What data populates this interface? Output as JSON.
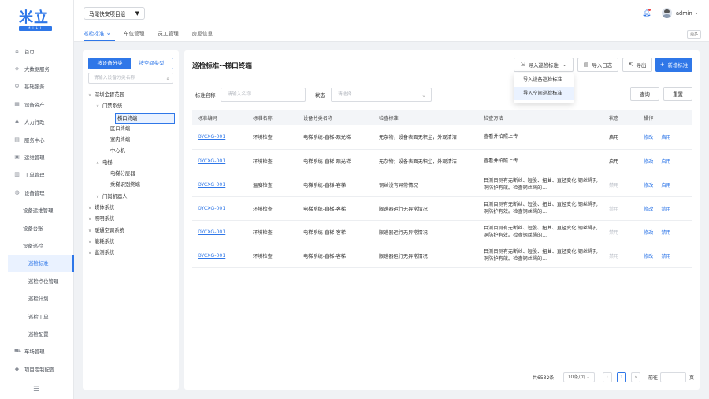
{
  "brand": {
    "logo_text": "米立",
    "logo_sub": "MILI"
  },
  "nav": [
    {
      "label": "首页",
      "icon": "home-icon",
      "glyph": "⌂",
      "level": 0
    },
    {
      "label": "大数据服务",
      "icon": "data-icon",
      "glyph": "◈",
      "level": 0
    },
    {
      "label": "基础服务",
      "icon": "service-icon",
      "glyph": "⚙",
      "level": 0
    },
    {
      "label": "设备资产",
      "icon": "asset-icon",
      "glyph": "▦",
      "level": 0
    },
    {
      "label": "人力行政",
      "icon": "people-icon",
      "glyph": "♟",
      "level": 0
    },
    {
      "label": "服务中心",
      "icon": "center-icon",
      "glyph": "▤",
      "level": 0
    },
    {
      "label": "运维管理",
      "icon": "ops-icon",
      "glyph": "▣",
      "level": 0
    },
    {
      "label": "工单管理",
      "icon": "ticket-icon",
      "glyph": "▥",
      "level": 0
    },
    {
      "label": "设备管理",
      "icon": "device-icon",
      "glyph": "◍",
      "level": 0
    },
    {
      "label": "设备运维管理",
      "level": 1
    },
    {
      "label": "设备台账",
      "level": 1
    },
    {
      "label": "设备巡检",
      "level": 1
    },
    {
      "label": "巡检标准",
      "level": 2,
      "active": true
    },
    {
      "label": "巡检点位管理",
      "level": 2
    },
    {
      "label": "巡检计划",
      "level": 2
    },
    {
      "label": "巡检工单",
      "level": 2
    },
    {
      "label": "巡检配置",
      "level": 2
    },
    {
      "label": "车场管理",
      "icon": "car-icon",
      "glyph": "⛟",
      "level": 0
    },
    {
      "label": "项目定制配置",
      "icon": "config-icon",
      "glyph": "◆",
      "level": 0
    }
  ],
  "topbar": {
    "project": "马尾快安项目组",
    "user": "admin",
    "more": "更多"
  },
  "tabs": [
    {
      "label": "巡检标准",
      "active": true
    },
    {
      "label": "车位管理"
    },
    {
      "label": "员工管理"
    },
    {
      "label": "房屋信息"
    }
  ],
  "left": {
    "seg_on": "按设备分类",
    "seg_off": "按空间类型",
    "search_placeholder": "请输入设备分类名称",
    "tree": [
      {
        "label": "深圳金碧花园",
        "depth": 0,
        "caret": "∨"
      },
      {
        "label": "门禁系统",
        "depth": 1,
        "caret": "∨"
      },
      {
        "label": "梯口终端",
        "depth": 2,
        "selected": true
      },
      {
        "label": "区口终端",
        "depth": 2
      },
      {
        "label": "室内终端",
        "depth": 2
      },
      {
        "label": "中心机",
        "depth": 2
      },
      {
        "label": "电梯",
        "depth": 1,
        "caret": "∧"
      },
      {
        "label": "电梯分层器",
        "depth": 2
      },
      {
        "label": "乘梯识别终端",
        "depth": 2
      },
      {
        "label": "门岗机器人",
        "depth": 1,
        "caret": "∨"
      },
      {
        "label": "媒体系统",
        "depth": 0,
        "caret": "∨"
      },
      {
        "label": "照明系统",
        "depth": 0,
        "caret": "∨"
      },
      {
        "label": "暖通空调系统",
        "depth": 0,
        "caret": "∨"
      },
      {
        "label": "能耗系统",
        "depth": 0,
        "caret": "∨"
      },
      {
        "label": "监测系统",
        "depth": 0,
        "caret": "∨"
      }
    ]
  },
  "main": {
    "title": "巡检标准--梯口终端",
    "buttons": {
      "import": "导入巡检标准",
      "log": "导入日志",
      "export": "导出",
      "add": "新增标准"
    },
    "dropdown": [
      "导入设备巡检标准",
      "导入空间巡检标准"
    ],
    "filters": {
      "name_label": "标准名称",
      "name_placeholder": "请输入名称",
      "status_label": "状态",
      "status_placeholder": "请选择",
      "query": "查询",
      "reset": "重置"
    },
    "columns": [
      "标准编码",
      "标准名称",
      "设备分类名称",
      "检查标准",
      "检查方法",
      "状态",
      "操作"
    ],
    "rows": [
      {
        "code": "DYCXG-001",
        "name": "环境检查",
        "cat": "电梯系统-直梯-观光梯",
        "std": "无杂物；设备表面无积尘，外观清洁",
        "method": "查看并拍照上传",
        "status": "启用",
        "op1": "修改",
        "op2": "启用",
        "enabled": true
      },
      {
        "code": "DYCXG-001",
        "name": "环境检查",
        "cat": "电梯系统-直梯-观光梯",
        "std": "无杂物；设备表面无积尘，外观清洁",
        "method": "查看并拍照上传",
        "status": "启用",
        "op1": "修改",
        "op2": "启用",
        "enabled": true
      },
      {
        "code": "DYCXG-001",
        "name": "温度检查",
        "cat": "电梯系统-直梯-客梯",
        "std": "钢丝没有异常情况",
        "method": "目测目测有无断丝、短股、扭曲、直径变化;钢丝绳孔洞防护有效。检查钢丝绳的...",
        "status": "禁用",
        "op1": "修改",
        "op2": "启用",
        "enabled": false
      },
      {
        "code": "DYCXG-001",
        "name": "环境检查",
        "cat": "电梯系统-直梯-客梯",
        "std": "限速器运行无异常情况",
        "method": "目测目测有无断丝、短股、扭曲、直径变化;钢丝绳孔洞防护有效。检查钢丝绳的...",
        "status": "禁用",
        "op1": "修改",
        "op2": "禁用",
        "enabled": false
      },
      {
        "code": "DYCXG-001",
        "name": "环境检查",
        "cat": "电梯系统-直梯-客梯",
        "std": "限速器运行无异常情况",
        "method": "目测目测有无断丝、短股、扭曲、直径变化;钢丝绳孔洞防护有效。检查钢丝绳的...",
        "status": "禁用",
        "op1": "修改",
        "op2": "禁用",
        "enabled": false
      },
      {
        "code": "DYCXG-001",
        "name": "环境检查",
        "cat": "电梯系统-直梯-客梯",
        "std": "限速器运行无异常情况",
        "method": "目测目测有无断丝、短股、扭曲、直径变化;钢丝绳孔洞防护有效。检查钢丝绳的...",
        "status": "禁用",
        "op1": "修改",
        "op2": "禁用",
        "enabled": false
      }
    ],
    "pagination": {
      "total": "共6532条",
      "size": "10条/页",
      "current": "1",
      "goto": "前往",
      "page_unit": "页"
    }
  },
  "colors": {
    "accent": "#2f77e8",
    "disabled": "#c0c4cc"
  }
}
